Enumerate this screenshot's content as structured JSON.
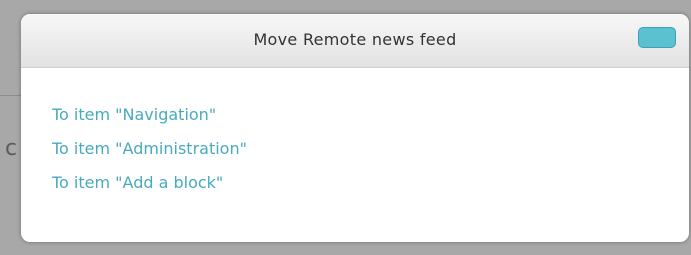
{
  "dialog": {
    "title": "Move Remote news feed",
    "close_button_color": "#5bc0d0"
  },
  "targets": [
    {
      "label": "To item \"Navigation\""
    },
    {
      "label": "To item \"Administration\""
    },
    {
      "label": "To item \"Add a block\""
    }
  ],
  "backdrop": {
    "partial_glyph": "c"
  },
  "colors": {
    "link": "#48aabe",
    "header_text": "#333333"
  }
}
